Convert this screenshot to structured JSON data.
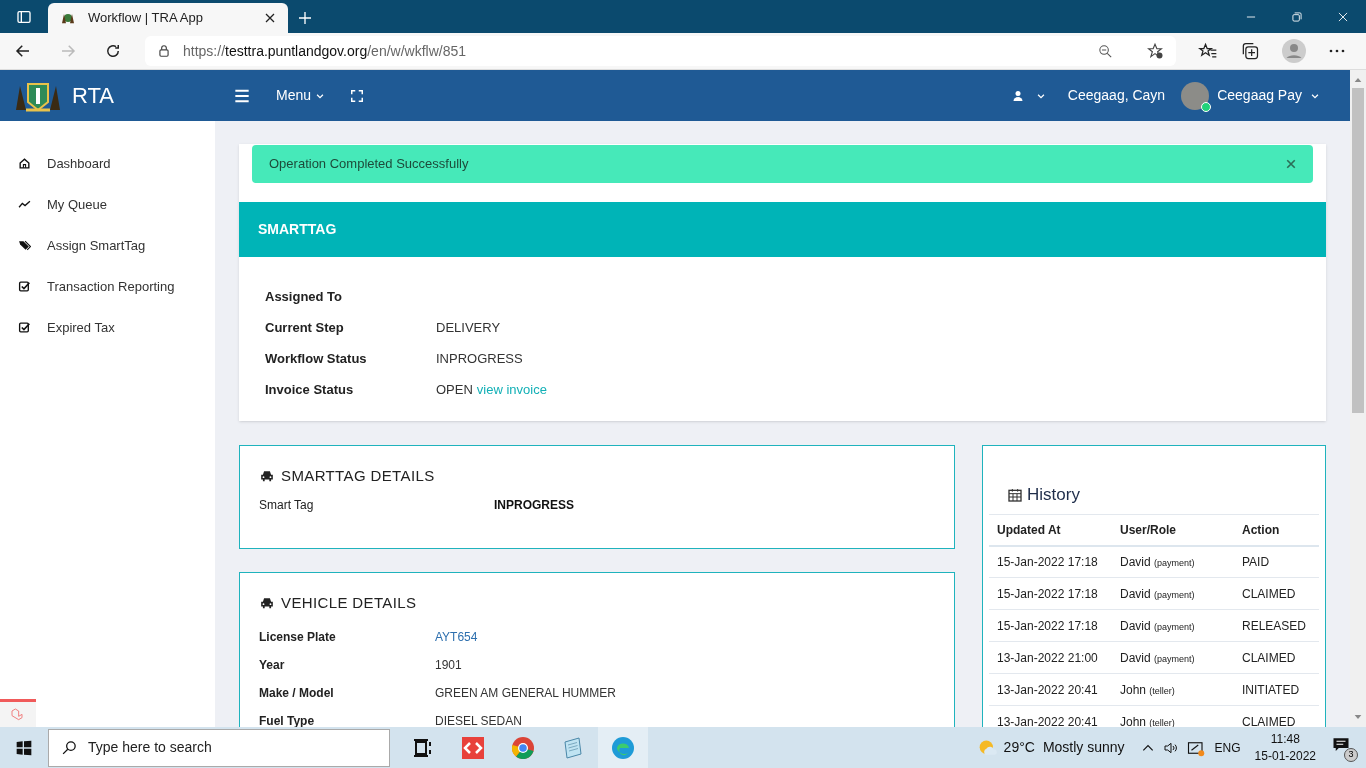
{
  "browser": {
    "tab_title": "Workflow | TRA App",
    "url_scheme": "https://",
    "url_host": "testtra.puntlandgov.org",
    "url_path": "/en/w/wkflw/851"
  },
  "header": {
    "brand": "RTA",
    "menu_label": "Menu",
    "user_short": "Ceegaag, Cayn",
    "user_name": "Ceegaag Pay",
    "online": true
  },
  "sidebar": {
    "items": [
      {
        "label": "Dashboard"
      },
      {
        "label": "My Queue"
      },
      {
        "label": "Assign SmartTag"
      },
      {
        "label": "Transaction Reporting"
      },
      {
        "label": "Expired Tax"
      }
    ]
  },
  "alert": {
    "text": "Operation Completed Successfully"
  },
  "smarttag": {
    "title": "SMARTTAG",
    "fields": [
      {
        "label": "Assigned To"
      },
      {
        "label": "Current Step",
        "value": "DELIVERY"
      },
      {
        "label": "Workflow Status",
        "value": "INPROGRESS"
      },
      {
        "label": "Invoice Status",
        "value": "OPEN",
        "link": "view invoice"
      }
    ]
  },
  "smarttag_details": {
    "title": "SMARTTAG DETAILS",
    "rows": [
      {
        "label": "Smart Tag",
        "value": "INPROGRESS"
      }
    ]
  },
  "vehicle_details": {
    "title": "VEHICLE DETAILS",
    "rows": [
      {
        "label": "License Plate",
        "value": "AYT654",
        "kind": "link"
      },
      {
        "label": "Year",
        "value": "1901",
        "kind": "text"
      },
      {
        "label": "Make / Model",
        "value": "GREEN AM GENERAL HUMMER",
        "kind": "text"
      },
      {
        "label": "Fuel Type",
        "value": "DIESEL SEDAN",
        "kind": "text"
      }
    ]
  },
  "history": {
    "title": "History",
    "columns": [
      "Updated At",
      "User/Role",
      "Action"
    ],
    "rows": [
      {
        "updated_at": "15-Jan-2022 17:18",
        "user": "David",
        "role": "(payment)",
        "action": "PAID"
      },
      {
        "updated_at": "15-Jan-2022 17:18",
        "user": "David",
        "role": "(payment)",
        "action": "CLAIMED"
      },
      {
        "updated_at": "15-Jan-2022 17:18",
        "user": "David",
        "role": "(payment)",
        "action": "RELEASED"
      },
      {
        "updated_at": "13-Jan-2022 21:00",
        "user": "David",
        "role": "(payment)",
        "action": "CLAIMED"
      },
      {
        "updated_at": "13-Jan-2022 20:41",
        "user": "John",
        "role": "(teller)",
        "action": "INITIATED"
      },
      {
        "updated_at": "13-Jan-2022 20:41",
        "user": "John",
        "role": "(teller)",
        "action": "CLAIMED"
      }
    ]
  },
  "taskbar": {
    "search_placeholder": "Type here to search",
    "temperature": "29°C",
    "weather": "Mostly sunny",
    "language": "ENG",
    "time": "11:48",
    "date": "15-01-2022",
    "notifications": "3"
  }
}
